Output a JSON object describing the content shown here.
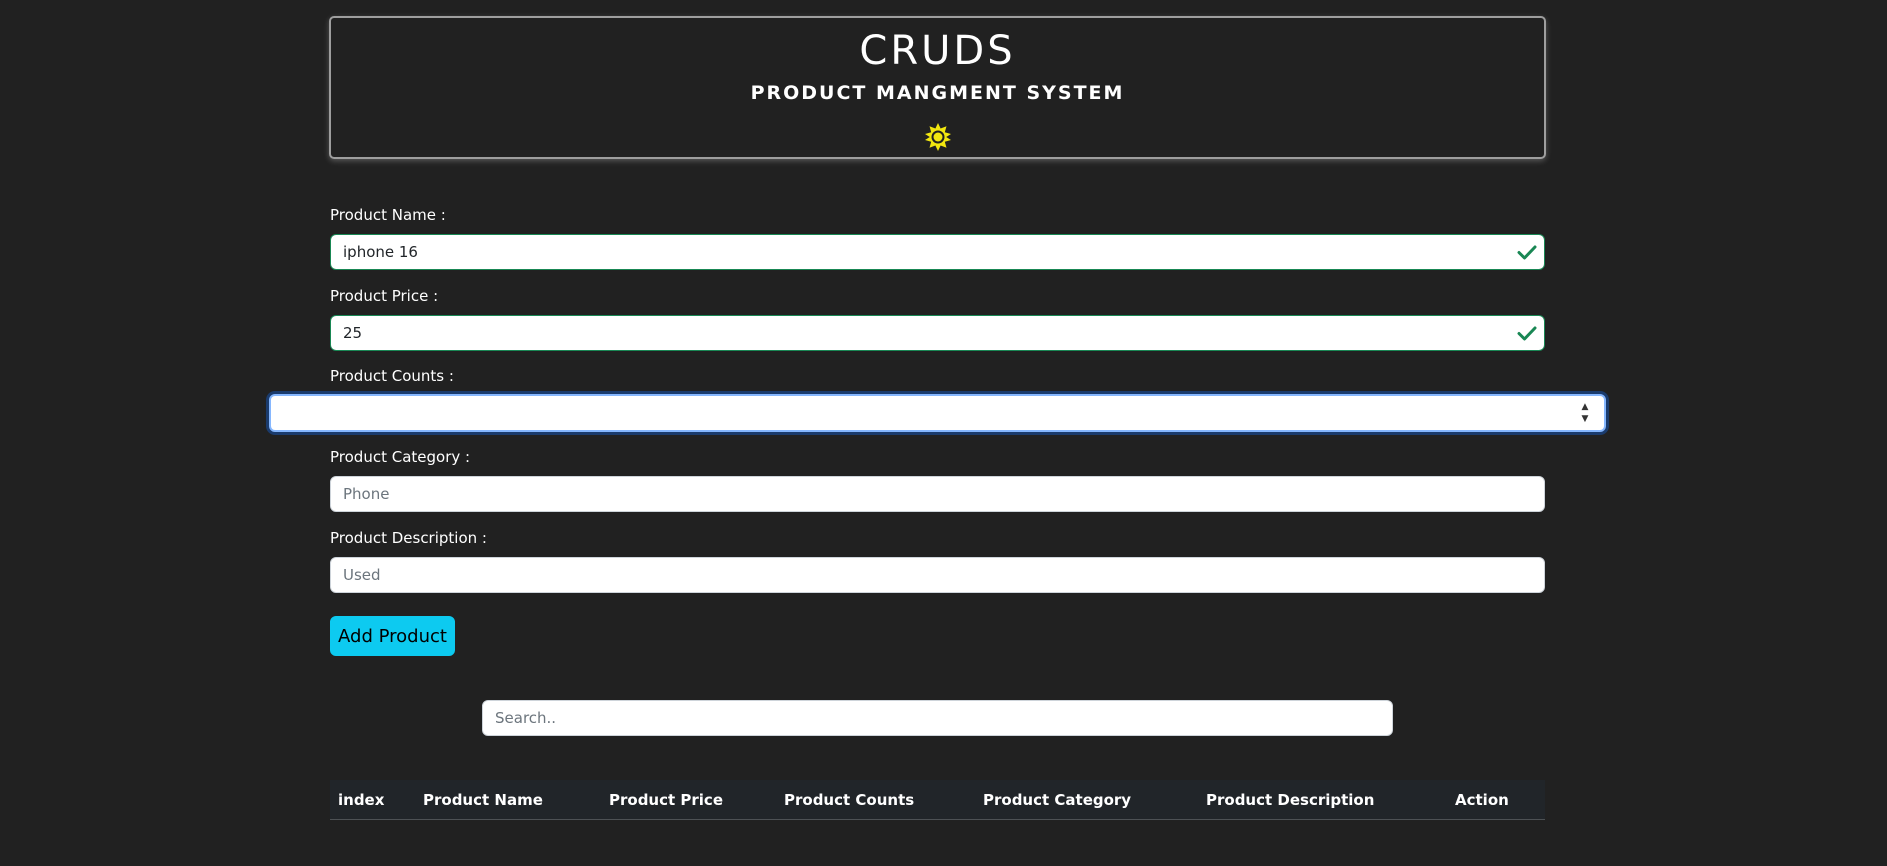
{
  "header": {
    "title": "CRUDS",
    "subtitle": "PRODUCT MANGMENT SYSTEM",
    "theme_icon": "sun-icon",
    "theme_icon_color": "#f2e70f"
  },
  "form": {
    "name": {
      "label": "Product Name :",
      "value": "iphone 16",
      "placeholder": ""
    },
    "price": {
      "label": "Product Price :",
      "value": "25",
      "placeholder": ""
    },
    "counts": {
      "label": "Product Counts :",
      "value": "",
      "placeholder": ""
    },
    "category": {
      "label": "Product Category :",
      "value": "",
      "placeholder": "Phone"
    },
    "description": {
      "label": "Product Description :",
      "value": "",
      "placeholder": "Used"
    },
    "valid_color": "#198754",
    "focus_color": "#86b7fe"
  },
  "add_button": {
    "label": "Add Product",
    "color": "#0dcaf0"
  },
  "search": {
    "placeholder": "Search.."
  },
  "table": {
    "headers": [
      "index",
      "Product Name",
      "Product Price",
      "Product Counts",
      "Product Category",
      "Product Description",
      "Action"
    ],
    "rows": []
  }
}
